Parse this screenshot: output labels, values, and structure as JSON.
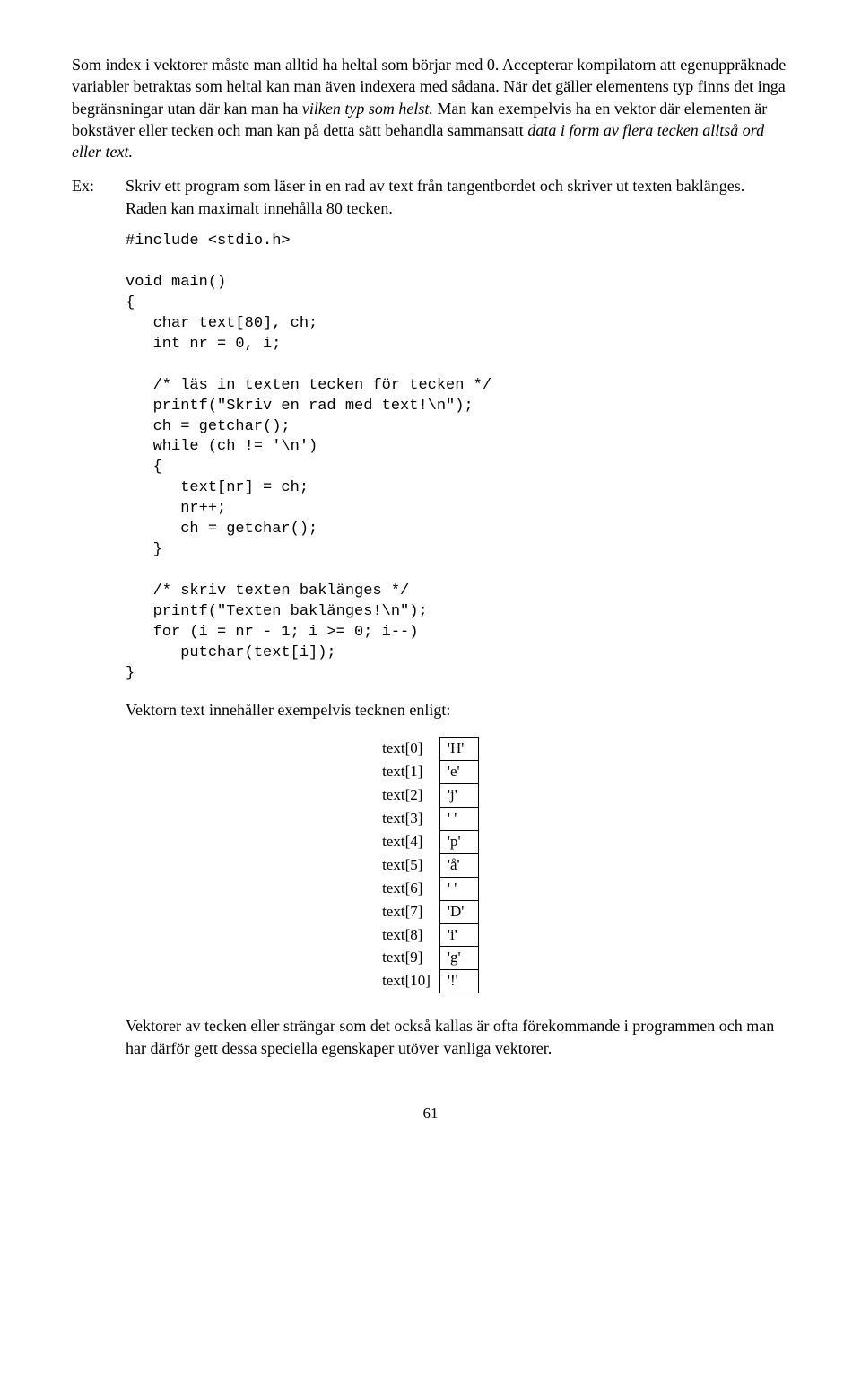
{
  "para1_a": "Som index i vektorer måste man alltid ha heltal som börjar med 0. Accepterar kompilatorn att egenuppräknade variabler betraktas som heltal kan man även indexera med sådana. När det gäller elementens typ finns det inga begränsningar utan där kan man ha ",
  "para1_b": "vilken typ som helst.",
  "para1_c": " Man kan exempelvis ha en vektor där elementen är bokstäver eller tecken och man kan på detta sätt behandla sammansatt ",
  "para1_d": "data i form av flera tecken alltså ord eller text.",
  "ex_label": "Ex:",
  "ex_text": "Skriv ett program som läser in en rad av text från tangentbordet och skriver ut texten baklänges. Raden kan maximalt innehålla 80 tecken.",
  "code": "#include <stdio.h>\n\nvoid main()\n{\n   char text[80], ch;\n   int nr = 0, i;\n\n   /* läs in texten tecken för tecken */\n   printf(\"Skriv en rad med text!\\n\");\n   ch = getchar();\n   while (ch != '\\n')\n   {\n      text[nr] = ch;\n      nr++;\n      ch = getchar();\n   }\n\n   /* skriv texten baklänges */\n   printf(\"Texten baklänges!\\n\");\n   for (i = nr - 1; i >= 0; i--)\n      putchar(text[i]);\n}",
  "after_code": "Vektorn text innehåller exempelvis tecknen enligt:",
  "table": [
    {
      "idx": "text[0]",
      "val": "'H'"
    },
    {
      "idx": "text[1]",
      "val": "'e'"
    },
    {
      "idx": "text[2]",
      "val": "'j'"
    },
    {
      "idx": "text[3]",
      "val": "' '"
    },
    {
      "idx": "text[4]",
      "val": "'p'"
    },
    {
      "idx": "text[5]",
      "val": "'å'"
    },
    {
      "idx": "text[6]",
      "val": "' '"
    },
    {
      "idx": "text[7]",
      "val": "'D'"
    },
    {
      "idx": "text[8]",
      "val": "'i'"
    },
    {
      "idx": "text[9]",
      "val": "'g'"
    },
    {
      "idx": "text[10]",
      "val": "'!'"
    }
  ],
  "last_para": "Vektorer av tecken eller strängar som det också kallas är ofta förekommande i programmen och man har därför gett dessa speciella egenskaper utöver vanliga vektorer.",
  "page_num": "61"
}
